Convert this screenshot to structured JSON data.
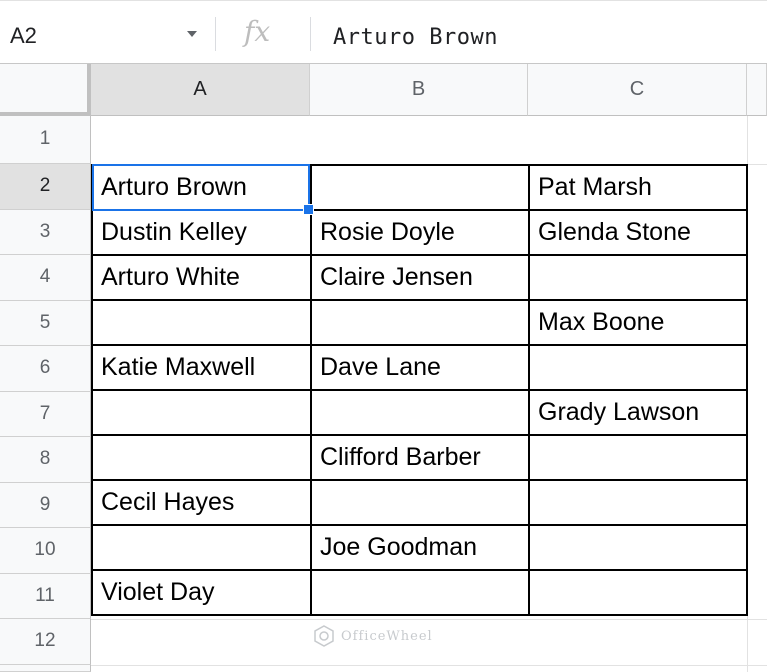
{
  "formula_bar": {
    "name_box": "A2",
    "fx_label": "fx",
    "value": "Arturo Brown"
  },
  "columns": [
    "A",
    "B",
    "C"
  ],
  "rows": [
    "1",
    "2",
    "3",
    "4",
    "5",
    "6",
    "7",
    "8",
    "9",
    "10",
    "11",
    "12"
  ],
  "selected_cell": "A2",
  "table": [
    [
      "Arturo Brown",
      "",
      "Pat Marsh"
    ],
    [
      "Dustin Kelley",
      "Rosie Doyle",
      "Glenda Stone"
    ],
    [
      "Arturo White",
      "Claire Jensen",
      ""
    ],
    [
      "",
      "",
      "Max Boone"
    ],
    [
      "Katie Maxwell",
      "Dave Lane",
      ""
    ],
    [
      "",
      "",
      "Grady Lawson"
    ],
    [
      "",
      "Clifford Barber",
      ""
    ],
    [
      "Cecil Hayes",
      "",
      ""
    ],
    [
      "",
      "Joe Goodman",
      ""
    ],
    [
      "Violet Day",
      "",
      ""
    ]
  ],
  "watermark": "OfficeWheel",
  "colors": {
    "selection": "#1a73e8",
    "header_bg": "#f8f9fa",
    "header_selected_bg": "#e1e1e1"
  }
}
